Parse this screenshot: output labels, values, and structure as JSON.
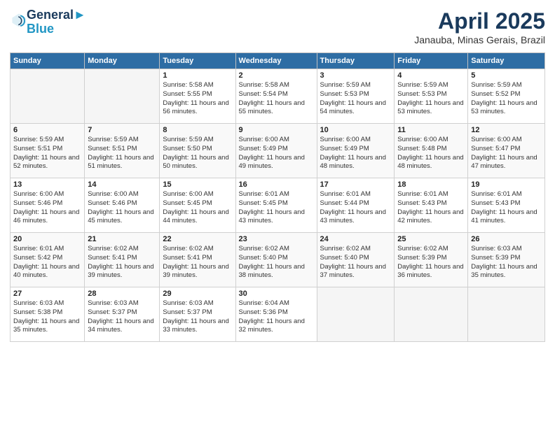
{
  "header": {
    "logo_line1": "General",
    "logo_line2": "Blue",
    "month": "April 2025",
    "location": "Janauba, Minas Gerais, Brazil"
  },
  "columns": [
    "Sunday",
    "Monday",
    "Tuesday",
    "Wednesday",
    "Thursday",
    "Friday",
    "Saturday"
  ],
  "weeks": [
    [
      {
        "day": "",
        "info": ""
      },
      {
        "day": "",
        "info": ""
      },
      {
        "day": "1",
        "info": "Sunrise: 5:58 AM\nSunset: 5:55 PM\nDaylight: 11 hours and 56 minutes."
      },
      {
        "day": "2",
        "info": "Sunrise: 5:58 AM\nSunset: 5:54 PM\nDaylight: 11 hours and 55 minutes."
      },
      {
        "day": "3",
        "info": "Sunrise: 5:59 AM\nSunset: 5:53 PM\nDaylight: 11 hours and 54 minutes."
      },
      {
        "day": "4",
        "info": "Sunrise: 5:59 AM\nSunset: 5:53 PM\nDaylight: 11 hours and 53 minutes."
      },
      {
        "day": "5",
        "info": "Sunrise: 5:59 AM\nSunset: 5:52 PM\nDaylight: 11 hours and 53 minutes."
      }
    ],
    [
      {
        "day": "6",
        "info": "Sunrise: 5:59 AM\nSunset: 5:51 PM\nDaylight: 11 hours and 52 minutes."
      },
      {
        "day": "7",
        "info": "Sunrise: 5:59 AM\nSunset: 5:51 PM\nDaylight: 11 hours and 51 minutes."
      },
      {
        "day": "8",
        "info": "Sunrise: 5:59 AM\nSunset: 5:50 PM\nDaylight: 11 hours and 50 minutes."
      },
      {
        "day": "9",
        "info": "Sunrise: 6:00 AM\nSunset: 5:49 PM\nDaylight: 11 hours and 49 minutes."
      },
      {
        "day": "10",
        "info": "Sunrise: 6:00 AM\nSunset: 5:49 PM\nDaylight: 11 hours and 48 minutes."
      },
      {
        "day": "11",
        "info": "Sunrise: 6:00 AM\nSunset: 5:48 PM\nDaylight: 11 hours and 48 minutes."
      },
      {
        "day": "12",
        "info": "Sunrise: 6:00 AM\nSunset: 5:47 PM\nDaylight: 11 hours and 47 minutes."
      }
    ],
    [
      {
        "day": "13",
        "info": "Sunrise: 6:00 AM\nSunset: 5:46 PM\nDaylight: 11 hours and 46 minutes."
      },
      {
        "day": "14",
        "info": "Sunrise: 6:00 AM\nSunset: 5:46 PM\nDaylight: 11 hours and 45 minutes."
      },
      {
        "day": "15",
        "info": "Sunrise: 6:00 AM\nSunset: 5:45 PM\nDaylight: 11 hours and 44 minutes."
      },
      {
        "day": "16",
        "info": "Sunrise: 6:01 AM\nSunset: 5:45 PM\nDaylight: 11 hours and 43 minutes."
      },
      {
        "day": "17",
        "info": "Sunrise: 6:01 AM\nSunset: 5:44 PM\nDaylight: 11 hours and 43 minutes."
      },
      {
        "day": "18",
        "info": "Sunrise: 6:01 AM\nSunset: 5:43 PM\nDaylight: 11 hours and 42 minutes."
      },
      {
        "day": "19",
        "info": "Sunrise: 6:01 AM\nSunset: 5:43 PM\nDaylight: 11 hours and 41 minutes."
      }
    ],
    [
      {
        "day": "20",
        "info": "Sunrise: 6:01 AM\nSunset: 5:42 PM\nDaylight: 11 hours and 40 minutes."
      },
      {
        "day": "21",
        "info": "Sunrise: 6:02 AM\nSunset: 5:41 PM\nDaylight: 11 hours and 39 minutes."
      },
      {
        "day": "22",
        "info": "Sunrise: 6:02 AM\nSunset: 5:41 PM\nDaylight: 11 hours and 39 minutes."
      },
      {
        "day": "23",
        "info": "Sunrise: 6:02 AM\nSunset: 5:40 PM\nDaylight: 11 hours and 38 minutes."
      },
      {
        "day": "24",
        "info": "Sunrise: 6:02 AM\nSunset: 5:40 PM\nDaylight: 11 hours and 37 minutes."
      },
      {
        "day": "25",
        "info": "Sunrise: 6:02 AM\nSunset: 5:39 PM\nDaylight: 11 hours and 36 minutes."
      },
      {
        "day": "26",
        "info": "Sunrise: 6:03 AM\nSunset: 5:39 PM\nDaylight: 11 hours and 35 minutes."
      }
    ],
    [
      {
        "day": "27",
        "info": "Sunrise: 6:03 AM\nSunset: 5:38 PM\nDaylight: 11 hours and 35 minutes."
      },
      {
        "day": "28",
        "info": "Sunrise: 6:03 AM\nSunset: 5:37 PM\nDaylight: 11 hours and 34 minutes."
      },
      {
        "day": "29",
        "info": "Sunrise: 6:03 AM\nSunset: 5:37 PM\nDaylight: 11 hours and 33 minutes."
      },
      {
        "day": "30",
        "info": "Sunrise: 6:04 AM\nSunset: 5:36 PM\nDaylight: 11 hours and 32 minutes."
      },
      {
        "day": "",
        "info": ""
      },
      {
        "day": "",
        "info": ""
      },
      {
        "day": "",
        "info": ""
      }
    ]
  ]
}
